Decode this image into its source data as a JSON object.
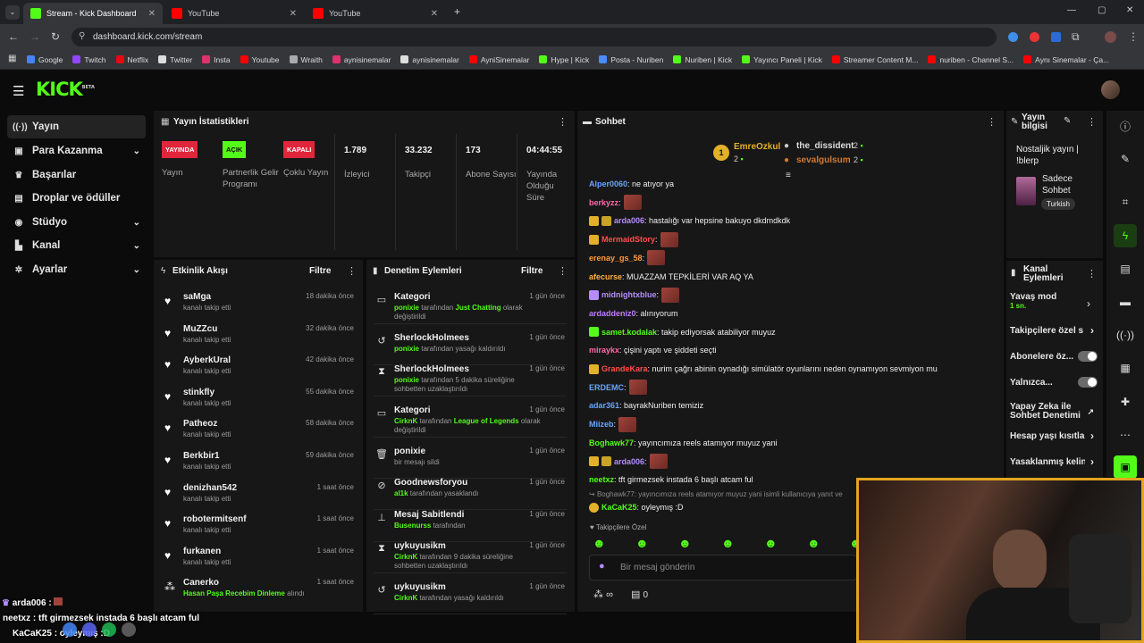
{
  "browser": {
    "tabs": [
      {
        "title": "Stream - Kick Dashboard",
        "active": true
      },
      {
        "title": "YouTube",
        "active": false
      },
      {
        "title": "YouTube",
        "active": false
      }
    ],
    "url": "dashboard.kick.com/stream",
    "bookmarks": [
      "Google",
      "Twitch",
      "Netflix",
      "Twitter",
      "Insta",
      "Youtube",
      "Wraith",
      "aynisinemalar",
      "aynisinemalar",
      "AyniSinemalar",
      "Hype | Kick",
      "Posta - Nuriben",
      "Nuriben | Kick",
      "Yayıncı Paneli | Kick",
      "Streamer Content M...",
      "nuriben - Channel S...",
      "Aynı Sinemalar - Ça..."
    ]
  },
  "logo": {
    "text": "KICK",
    "tag": "BETA"
  },
  "sidebar": {
    "items": [
      {
        "label": "Yayın",
        "icon": "broadcast-icon"
      },
      {
        "label": "Para Kazanma",
        "icon": "money-icon"
      },
      {
        "label": "Başarılar",
        "icon": "trophy-icon"
      },
      {
        "label": "Droplar ve ödüller",
        "icon": "gift-icon"
      },
      {
        "label": "Stüdyo",
        "icon": "studio-icon"
      },
      {
        "label": "Kanal",
        "icon": "channel-icon"
      },
      {
        "label": "Ayarlar",
        "icon": "settings-icon"
      }
    ]
  },
  "stats": {
    "title": "Yayın İstatistikleri",
    "items": [
      {
        "badge": "YAYINDA",
        "label": "Yayın",
        "color": "#e1253a"
      },
      {
        "badge": "AÇIK",
        "label": "Partnerlik Gelir Programı",
        "color": "#53fc18"
      },
      {
        "badge": "KAPALI",
        "label": "Çoklu Yayın",
        "color": "#e1253a"
      },
      {
        "value": "1.789",
        "label": "İzleyici"
      },
      {
        "value": "33.232",
        "label": "Takipçi"
      },
      {
        "value": "173",
        "label": "Abone Sayısı"
      },
      {
        "value": "04:44:55",
        "label": "Yayında Olduğu Süre"
      }
    ]
  },
  "activity": {
    "title": "Etkinlik Akışı",
    "filter": "Filtre",
    "items": [
      {
        "name": "saMga",
        "sub": "kanalı takip etti",
        "time": "18 dakika önce"
      },
      {
        "name": "MuZZcu",
        "sub": "kanalı takip etti",
        "time": "32 dakika önce"
      },
      {
        "name": "AyberkUral",
        "sub": "kanalı takip etti",
        "time": "42 dakika önce"
      },
      {
        "name": "stinkfly",
        "sub": "kanalı takip etti",
        "time": "55 dakika önce"
      },
      {
        "name": "Patheoz",
        "sub": "kanalı takip etti",
        "time": "58 dakika önce"
      },
      {
        "name": "Berkbir1",
        "sub": "kanalı takip etti",
        "time": "59 dakika önce"
      },
      {
        "name": "denizhan542",
        "sub": "kanalı takip etti",
        "time": "1 saat önce"
      },
      {
        "name": "robotermitsenf",
        "sub": "kanalı takip etti",
        "time": "1 saat önce"
      },
      {
        "name": "furkanen",
        "sub": "kanalı takip etti",
        "time": "1 saat önce"
      },
      {
        "name": "Canerko",
        "sub_green": "Hasan Paşa Recebim Dinleme",
        "sub": "alındı",
        "time": "1 saat önce"
      }
    ]
  },
  "moderation": {
    "title": "Denetim Eylemleri",
    "filter": "Filtre",
    "items": [
      {
        "title": "Kategori",
        "icon": "folder-icon",
        "time": "1 gün önce",
        "g1": "ponixie",
        "t1": " tarafından ",
        "g2": "Just Chatting",
        "t2": " olarak değiştirildi"
      },
      {
        "title": "SherlockHolmees",
        "icon": "undo-icon",
        "time": "1 gün önce",
        "g1": "ponixie",
        "t1": " tarafından yasağı kaldırıldı",
        "g2": "",
        "t2": ""
      },
      {
        "title": "SherlockHolmees",
        "icon": "hourglass-icon",
        "time": "1 gün önce",
        "g1": "ponixie",
        "t1": " tarafından 5 dakika süreliğine sohbetten uzaklaştırıldı",
        "g2": "",
        "t2": ""
      },
      {
        "title": "Kategori",
        "icon": "folder-icon",
        "time": "1 gün önce",
        "g1": "CirknK",
        "t1": " tarafından ",
        "g2": "League of Legends",
        "t2": " olarak değiştirildi"
      },
      {
        "title": "ponixie",
        "icon": "trash-icon",
        "time": "1 gün önce",
        "g1": "",
        "t1": "bir mesajı sildi",
        "g2": "",
        "t2": ""
      },
      {
        "title": "Goodnewsforyou",
        "icon": "ban-icon",
        "time": "1 gün önce",
        "g1": "al1k",
        "t1": " tarafından yasaklandı",
        "g2": "",
        "t2": ""
      },
      {
        "title": "Mesaj Sabitlendi",
        "icon": "pin-icon",
        "time": "1 gün önce",
        "g1": "Busenurss",
        "t1": " tarafından",
        "g2": "",
        "t2": ""
      },
      {
        "title": "uykuyusikm",
        "icon": "hourglass-icon",
        "time": "1 gün önce",
        "g1": "CirknK",
        "t1": " tarafından 9 dakika süreliğine sohbetten uzaklaştırıldı",
        "g2": "",
        "t2": ""
      },
      {
        "title": "uykuyusikm",
        "icon": "undo-icon",
        "time": "1 gün önce",
        "g1": "CirknK",
        "t1": " tarafından yasağı kaldırıldı",
        "g2": "",
        "t2": ""
      }
    ]
  },
  "chat": {
    "title": "Sohbet",
    "top_gifters": [
      {
        "name": "EmreOzkul",
        "count": "2"
      },
      {
        "name": "the_dissident",
        "count": "2"
      },
      {
        "name": "sevalgulsum",
        "count": "2"
      }
    ],
    "messages": [
      {
        "user": "Alper0060",
        "color": "#6aa4ff",
        "text": ": ne atıyor ya",
        "emote": false
      },
      {
        "user": "berkyzz",
        "color": "#ff6aa9",
        "text": ":",
        "emote": true
      },
      {
        "user": "arda006",
        "color": "#b58cff",
        "text": ": hastalığı var hepsine bakuyo dkdmdkdk",
        "emote": false
      },
      {
        "user": "MermaidStory",
        "color": "#ff4d4d",
        "text": ":",
        "emote": true
      },
      {
        "user": "erenay_gs_58",
        "color": "#ff9a3c",
        "text": ":",
        "emote": true
      },
      {
        "user": "afecurse",
        "color": "#ffb23c",
        "text": ": MUAZZAM TEPKİLERİ VAR AQ YA",
        "emote": false
      },
      {
        "user": "midnightxblue",
        "color": "#b58cff",
        "text": ":",
        "emote": true
      },
      {
        "user": "ardaddeniz0",
        "color": "#c07cff",
        "text": ": alınıyorum",
        "emote": false
      },
      {
        "user": "samet.kodalak",
        "color": "#53fc18",
        "text": ": takip ediyorsak atabiliyor muyuz",
        "emote": false
      },
      {
        "user": "miraykx",
        "color": "#ff6aa9",
        "text": ": çişini yaptı ve şiddeti seçti",
        "emote": false
      },
      {
        "user": "GrandeKara",
        "color": "#ff4d4d",
        "text": ": nurim çağrı abinin oynadığı simülatör oyunlarını neden oynamıyon sevmiyon mu",
        "emote": false
      },
      {
        "user": "ERDEMC",
        "color": "#6aa4ff",
        "text": ":",
        "emote": true
      },
      {
        "user": "adar361",
        "color": "#6aa4ff",
        "text": ": bayrakNuriben temiziz",
        "emote": false
      },
      {
        "user": "Miizeb",
        "color": "#6aa4ff",
        "text": ":",
        "emote": true
      },
      {
        "user": "Boghawk77",
        "color": "#53fc18",
        "text": ": yayıncımıza reels atamıyor muyuz yani",
        "emote": false
      },
      {
        "user": "arda006",
        "color": "#b58cff",
        "text": ":",
        "emote": true
      },
      {
        "user": "neetxz",
        "color": "#53fc18",
        "text": ": tft girmezsek instada 6 başlı atcam ful",
        "emote": false
      }
    ],
    "reply": "Boghawk77: yayıncımıza reels atamıyor muyuz yani isimli kullanıcıya yanıt ve",
    "last": {
      "user": "KaCaK25",
      "text": ": oyleymış :D"
    },
    "followers_only": "Takipçilere Özel",
    "input_placeholder": "Bir mesaj gönderin",
    "infinity": "∞",
    "zero": "0"
  },
  "stream_info": {
    "title": "Yayın bilgisi",
    "stream_title": "Nostaljik yayın | !blerp",
    "category": "Sadece Sohbet",
    "tag": "Turkish"
  },
  "channel_actions": {
    "title": "Kanal Eylemleri",
    "slow_mode": "Yavaş mod",
    "slow_val": "1 sn.",
    "followers": "Takipçilere özel s",
    "subs": "Abonelere öz...",
    "only": "Yalnızca...",
    "ai": "Yapay Zeka ile Sohbet Denetimi",
    "age": "Hesap yaşı kısıtla",
    "banned": "Yasaklanmış kelin"
  },
  "overlay": {
    "line1_user": "arda006",
    "line2": "neetxz : tft girmezsek instada 6 başlı atcam ful",
    "line3": "KaCaK25 : oyleymış :D"
  }
}
